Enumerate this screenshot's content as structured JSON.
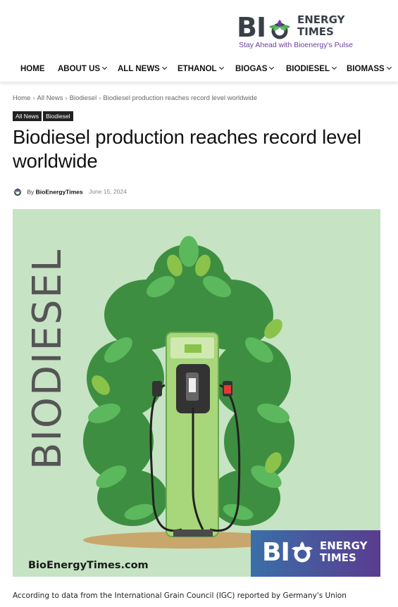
{
  "site": {
    "logo_bio": "BI",
    "logo_energy_line1": "ENERGY",
    "logo_energy_line2": "TIMES",
    "tagline": "Stay Ahead with Bioenergy's Pulse"
  },
  "nav": {
    "items": [
      {
        "label": "HOME",
        "has_dropdown": false
      },
      {
        "label": "ABOUT US",
        "has_dropdown": true
      },
      {
        "label": "ALL NEWS",
        "has_dropdown": true
      },
      {
        "label": "ETHANOL",
        "has_dropdown": true
      },
      {
        "label": "BIOGAS",
        "has_dropdown": true
      },
      {
        "label": "BIODIESEL",
        "has_dropdown": true
      },
      {
        "label": "BIOMASS",
        "has_dropdown": true
      }
    ]
  },
  "breadcrumb": {
    "items": [
      "Home",
      "All News",
      "Biodiesel",
      "Biodiesel production reaches record level worldwide"
    ]
  },
  "tags": [
    "All News",
    "Biodiesel"
  ],
  "article": {
    "title": "Biodiesel production reaches record level worldwide",
    "author_prefix": "By",
    "author": "BioEnergyTimes",
    "date": "June 15, 2024",
    "image_word": "BIODIESEL",
    "image_site": "BioEnergyTimes.com",
    "image_brand_bio": "BI",
    "image_brand_energy_line1": "ENERGY",
    "image_brand_energy_line2": "TIMES",
    "first_line": "According to data from the International Grain Council (IGC) reported by Germany's Union"
  },
  "colors": {
    "brand_purple": "#6b3fa0",
    "brand_dark": "#3a4049",
    "leaf_green": "#4caf50",
    "image_bg": "#c6e3c4"
  }
}
